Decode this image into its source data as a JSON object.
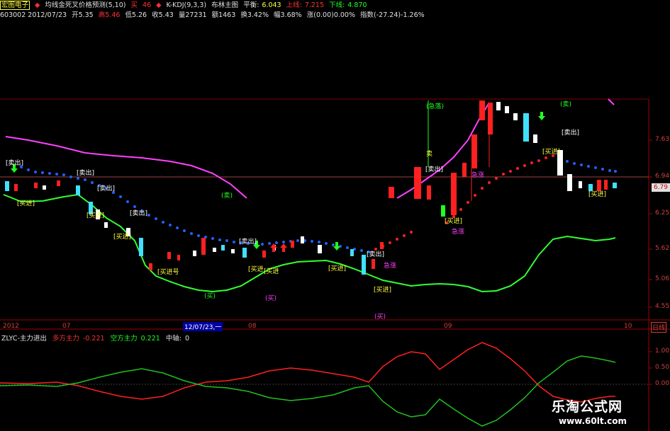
{
  "header1": {
    "stock_name": "宏图电子",
    "indicator_name": "均线金死叉价格预测(5,10)",
    "marker_buy": "买",
    "price1": "46",
    "indicator2": "K-KDJ(9,3,3)",
    "indicator3": "布林主图",
    "mid_label": "平衡:",
    "mid_value": "6.043",
    "upper_label": "上线:",
    "upper_value": "7.215",
    "lower_label": "下线:",
    "lower_value": "4.870"
  },
  "header2": {
    "code_date": "603002 2012/07/23",
    "open": "开5.35",
    "high": "高5.46",
    "low": "低5.26",
    "close": "收5.43",
    "volume": "量27231",
    "amount": "额1463",
    "turnover": "换3.42%",
    "change": "幅3.68%",
    "pct": "涨(0.00)0.00%",
    "index": "指数(-27.24)-1.26%"
  },
  "y_axis": [
    "7.63",
    "6.94",
    "6.25",
    "5.62",
    "5.06",
    "4.55"
  ],
  "current_price": "6.79",
  "sub_y_axis": [
    "1.00",
    "0.50",
    "0.00"
  ],
  "x_axis": {
    "year": "2012",
    "m07": "07",
    "cursor_date": "12/07/23,一",
    "m08": "08",
    "m09": "09",
    "m10": "10",
    "tab": "日线"
  },
  "annotations": {
    "sell": "[卖出]",
    "buy": "[买进]",
    "buy_signal": "[买进号",
    "buy_b": "[买进",
    "buy_c": "[买进]",
    "warn": "涨",
    "rush": "急涨",
    "soar": "急涨",
    "seller": "(卖)",
    "buyer": "(买)",
    "drop": "(急落)",
    "sell_short": "卖",
    "extra": "涨"
  },
  "sub_header": {
    "name": "ZLYC-主力进出",
    "bull_label": "多方主力",
    "bull_value": "-0.221",
    "bear_label": "空方主力",
    "bear_value": "0.221",
    "mid_label": "中轴:",
    "mid_value": "0"
  },
  "watermark": {
    "name": "乐淘公式网",
    "url": "www.60lt.com"
  },
  "colors": {
    "up": "#ff2020",
    "down": "#40e0ff",
    "boll_upper": "#ff40ff",
    "boll_lower": "#20ff20",
    "mid_dots_up": "#ff2020",
    "mid_dots_down": "#2060ff",
    "bull": "#ff2020",
    "bear": "#20c020"
  }
}
